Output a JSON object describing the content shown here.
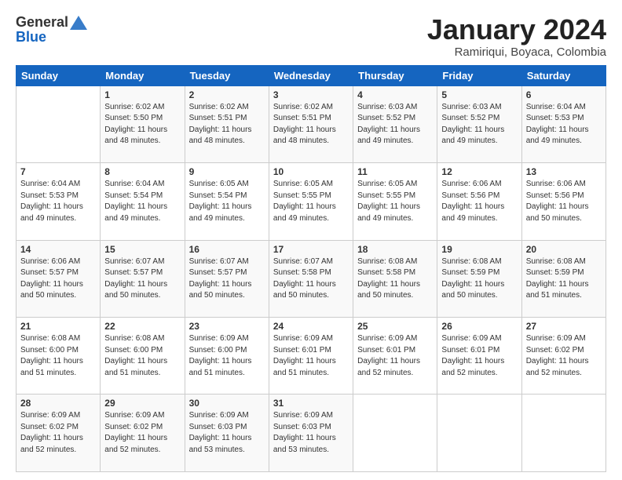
{
  "logo": {
    "general": "General",
    "blue": "Blue"
  },
  "header": {
    "title": "January 2024",
    "subtitle": "Ramiriqui, Boyaca, Colombia"
  },
  "days": [
    "Sunday",
    "Monday",
    "Tuesday",
    "Wednesday",
    "Thursday",
    "Friday",
    "Saturday"
  ],
  "weeks": [
    [
      {
        "day": "",
        "content": ""
      },
      {
        "day": "1",
        "content": "Sunrise: 6:02 AM\nSunset: 5:50 PM\nDaylight: 11 hours\nand 48 minutes."
      },
      {
        "day": "2",
        "content": "Sunrise: 6:02 AM\nSunset: 5:51 PM\nDaylight: 11 hours\nand 48 minutes."
      },
      {
        "day": "3",
        "content": "Sunrise: 6:02 AM\nSunset: 5:51 PM\nDaylight: 11 hours\nand 48 minutes."
      },
      {
        "day": "4",
        "content": "Sunrise: 6:03 AM\nSunset: 5:52 PM\nDaylight: 11 hours\nand 49 minutes."
      },
      {
        "day": "5",
        "content": "Sunrise: 6:03 AM\nSunset: 5:52 PM\nDaylight: 11 hours\nand 49 minutes."
      },
      {
        "day": "6",
        "content": "Sunrise: 6:04 AM\nSunset: 5:53 PM\nDaylight: 11 hours\nand 49 minutes."
      }
    ],
    [
      {
        "day": "7",
        "content": "Sunrise: 6:04 AM\nSunset: 5:53 PM\nDaylight: 11 hours\nand 49 minutes."
      },
      {
        "day": "8",
        "content": "Sunrise: 6:04 AM\nSunset: 5:54 PM\nDaylight: 11 hours\nand 49 minutes."
      },
      {
        "day": "9",
        "content": "Sunrise: 6:05 AM\nSunset: 5:54 PM\nDaylight: 11 hours\nand 49 minutes."
      },
      {
        "day": "10",
        "content": "Sunrise: 6:05 AM\nSunset: 5:55 PM\nDaylight: 11 hours\nand 49 minutes."
      },
      {
        "day": "11",
        "content": "Sunrise: 6:05 AM\nSunset: 5:55 PM\nDaylight: 11 hours\nand 49 minutes."
      },
      {
        "day": "12",
        "content": "Sunrise: 6:06 AM\nSunset: 5:56 PM\nDaylight: 11 hours\nand 49 minutes."
      },
      {
        "day": "13",
        "content": "Sunrise: 6:06 AM\nSunset: 5:56 PM\nDaylight: 11 hours\nand 50 minutes."
      }
    ],
    [
      {
        "day": "14",
        "content": "Sunrise: 6:06 AM\nSunset: 5:57 PM\nDaylight: 11 hours\nand 50 minutes."
      },
      {
        "day": "15",
        "content": "Sunrise: 6:07 AM\nSunset: 5:57 PM\nDaylight: 11 hours\nand 50 minutes."
      },
      {
        "day": "16",
        "content": "Sunrise: 6:07 AM\nSunset: 5:57 PM\nDaylight: 11 hours\nand 50 minutes."
      },
      {
        "day": "17",
        "content": "Sunrise: 6:07 AM\nSunset: 5:58 PM\nDaylight: 11 hours\nand 50 minutes."
      },
      {
        "day": "18",
        "content": "Sunrise: 6:08 AM\nSunset: 5:58 PM\nDaylight: 11 hours\nand 50 minutes."
      },
      {
        "day": "19",
        "content": "Sunrise: 6:08 AM\nSunset: 5:59 PM\nDaylight: 11 hours\nand 50 minutes."
      },
      {
        "day": "20",
        "content": "Sunrise: 6:08 AM\nSunset: 5:59 PM\nDaylight: 11 hours\nand 51 minutes."
      }
    ],
    [
      {
        "day": "21",
        "content": "Sunrise: 6:08 AM\nSunset: 6:00 PM\nDaylight: 11 hours\nand 51 minutes."
      },
      {
        "day": "22",
        "content": "Sunrise: 6:08 AM\nSunset: 6:00 PM\nDaylight: 11 hours\nand 51 minutes."
      },
      {
        "day": "23",
        "content": "Sunrise: 6:09 AM\nSunset: 6:00 PM\nDaylight: 11 hours\nand 51 minutes."
      },
      {
        "day": "24",
        "content": "Sunrise: 6:09 AM\nSunset: 6:01 PM\nDaylight: 11 hours\nand 51 minutes."
      },
      {
        "day": "25",
        "content": "Sunrise: 6:09 AM\nSunset: 6:01 PM\nDaylight: 11 hours\nand 52 minutes."
      },
      {
        "day": "26",
        "content": "Sunrise: 6:09 AM\nSunset: 6:01 PM\nDaylight: 11 hours\nand 52 minutes."
      },
      {
        "day": "27",
        "content": "Sunrise: 6:09 AM\nSunset: 6:02 PM\nDaylight: 11 hours\nand 52 minutes."
      }
    ],
    [
      {
        "day": "28",
        "content": "Sunrise: 6:09 AM\nSunset: 6:02 PM\nDaylight: 11 hours\nand 52 minutes."
      },
      {
        "day": "29",
        "content": "Sunrise: 6:09 AM\nSunset: 6:02 PM\nDaylight: 11 hours\nand 52 minutes."
      },
      {
        "day": "30",
        "content": "Sunrise: 6:09 AM\nSunset: 6:03 PM\nDaylight: 11 hours\nand 53 minutes."
      },
      {
        "day": "31",
        "content": "Sunrise: 6:09 AM\nSunset: 6:03 PM\nDaylight: 11 hours\nand 53 minutes."
      },
      {
        "day": "",
        "content": ""
      },
      {
        "day": "",
        "content": ""
      },
      {
        "day": "",
        "content": ""
      }
    ]
  ]
}
